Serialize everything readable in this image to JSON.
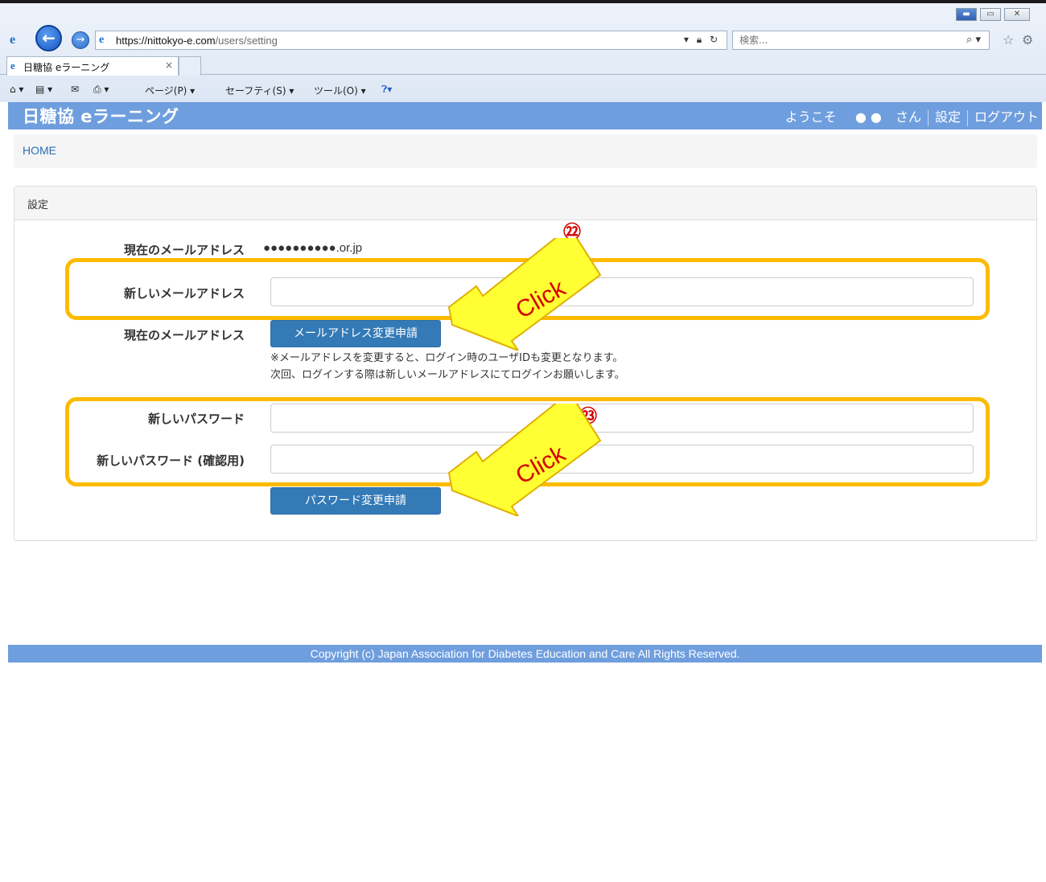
{
  "browser": {
    "window_controls": {
      "minimize": "▬",
      "maximize": "▭",
      "close": "✕"
    },
    "address": {
      "scheme_host": "https://nittokyo-e.com",
      "path": "/users/setting"
    },
    "search": {
      "placeholder": "検索..."
    },
    "tab": {
      "title": "日糖協 eラーニング",
      "close": "×"
    },
    "commands": {
      "page": "ページ(P) ▾",
      "safety": "セーフティ(S) ▾",
      "tools": "ツール(O) ▾"
    },
    "icons": [
      "ie-logo-icon",
      "back-arrow-icon",
      "forward-arrow-icon",
      "lock-icon",
      "refresh-icon",
      "search-icon",
      "star-icon",
      "gear-icon",
      "home-icon",
      "feed-icon",
      "mail-icon",
      "print-icon",
      "help-icon"
    ]
  },
  "header": {
    "brand": "日糖協 eラーニング",
    "welcome": "ようこそ",
    "user_mask": "● ●",
    "honorific": "さん",
    "settings_link": "設定",
    "logout_link": "ログアウト"
  },
  "breadcrumb": {
    "home": "HOME"
  },
  "panel": {
    "title": "設定",
    "current_email_label": "現在のメールアドレス",
    "current_email_value": "●●●●●●●●●●.or.jp",
    "new_email_label": "新しいメールアドレス",
    "new_email_value": "",
    "request_row_label": "現在のメールアドレス",
    "email_change_button": "メールアドレス変更申請",
    "email_note_1": "※メールアドレスを変更すると、ログイン時のユーザIDも変更となります。",
    "email_note_2": "次回、ログインする際は新しいメールアドレスにてログインお願いします。",
    "new_password_label": "新しいパスワード",
    "new_password_value": "",
    "confirm_password_label": "新しいパスワード (確認用)",
    "confirm_password_value": "",
    "password_change_button": "パスワード変更申請"
  },
  "annotations": {
    "badge_email": "㉒",
    "badge_password": "㉓",
    "arrow_label_1": "Click",
    "arrow_label_2": "Click",
    "highlight_color": "#fcba00",
    "arrow_fill": "#ffff33",
    "badge_color": "#d40000"
  },
  "footer": {
    "copyright": "Copyright (c) Japan Association for Diabetes Education and Care All Rights Reserved."
  },
  "colors": {
    "header": "#6f9ede",
    "button": "#337ab7",
    "link": "#2a6fb5"
  }
}
